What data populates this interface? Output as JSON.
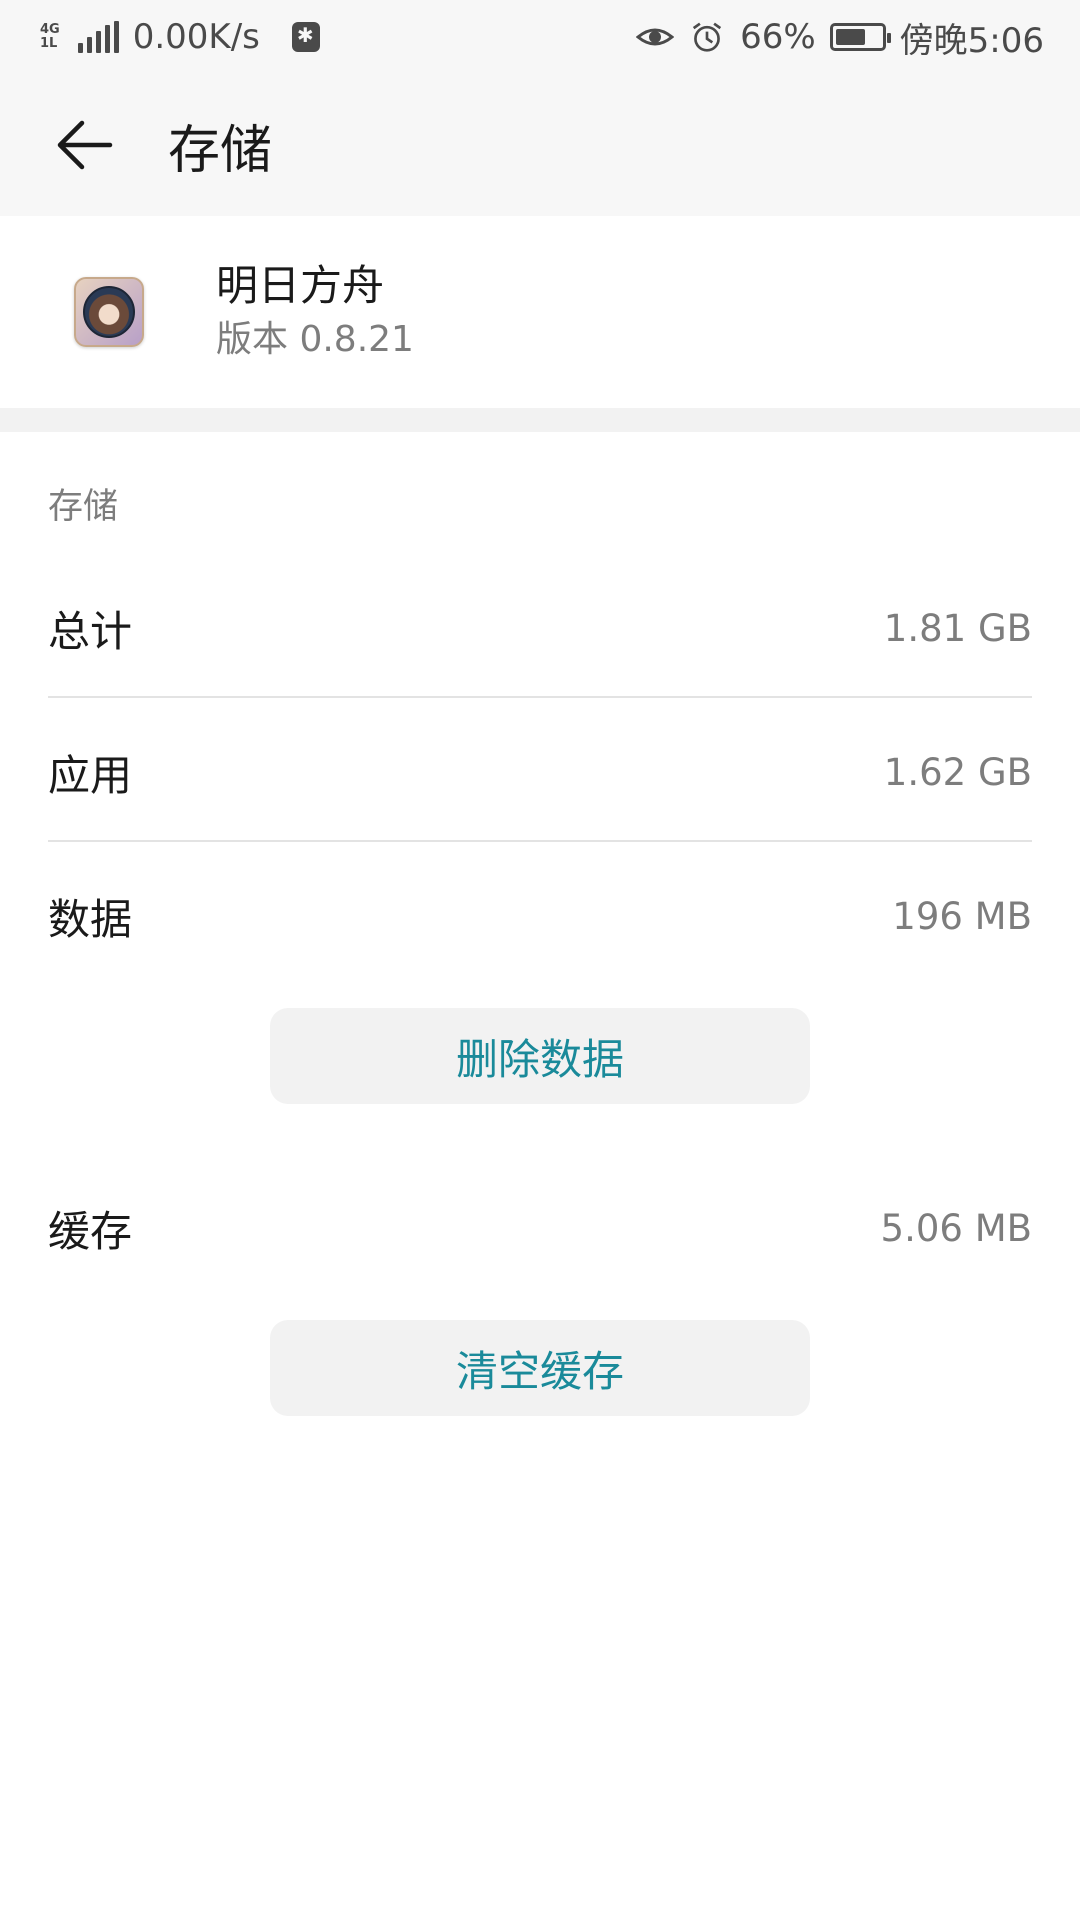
{
  "status_bar": {
    "network_type": "4G",
    "network_sub": "1L",
    "speed": "0.00K/s",
    "battery_percent_text": "66%",
    "battery_level": 0.66,
    "time": "傍晚5:06",
    "icons": [
      "signal-icon",
      "chat-notification-icon",
      "eye-icon",
      "alarm-icon",
      "battery-icon"
    ]
  },
  "header": {
    "title": "存储",
    "back_icon": "arrow-left-icon"
  },
  "app": {
    "name": "明日方舟",
    "version": "版本 0.8.21"
  },
  "storage": {
    "section_label": "存储",
    "rows": [
      {
        "label": "总计",
        "value": "1.81 GB"
      },
      {
        "label": "应用",
        "value": "1.62 GB"
      },
      {
        "label": "数据",
        "value": "196 MB"
      }
    ],
    "delete_data_label": "删除数据",
    "cache": {
      "label": "缓存",
      "value": "5.06 MB"
    },
    "clear_cache_label": "清空缓存"
  },
  "colors": {
    "accent": "#1a8a9a",
    "header_bg": "#f7f7f7",
    "secondary_text": "#7d7d7d"
  }
}
